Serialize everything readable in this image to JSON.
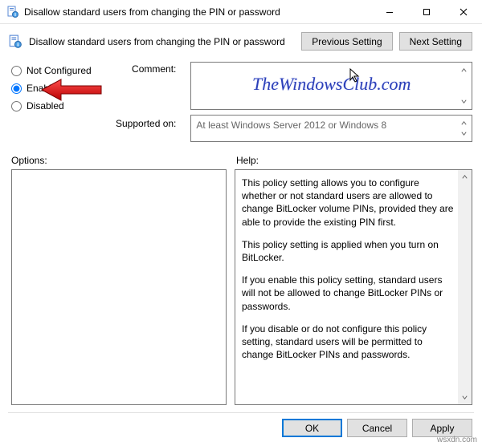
{
  "window": {
    "title": "Disallow standard users from changing the PIN or password"
  },
  "header": {
    "policy_title": "Disallow standard users from changing the PIN or password",
    "prev_label": "Previous Setting",
    "next_label": "Next Setting"
  },
  "radios": {
    "not_configured": "Not Configured",
    "enabled": "Enabled",
    "disabled": "Disabled",
    "selected": "enabled"
  },
  "labels": {
    "comment": "Comment:",
    "supported": "Supported on:",
    "options": "Options:",
    "help": "Help:"
  },
  "comment_value": "",
  "supported_value": "At least Windows Server 2012 or Windows 8",
  "help": {
    "p1": "This policy setting allows you to configure whether or not standard users are allowed to change BitLocker volume PINs, provided they are able to provide the existing PIN first.",
    "p2": "This policy setting is applied when you turn on BitLocker.",
    "p3": "If you enable this policy setting, standard users will not be allowed to change BitLocker PINs or passwords.",
    "p4": "If you disable or do not configure this policy setting, standard users will be permitted to change BitLocker PINs and passwords."
  },
  "footer": {
    "ok": "OK",
    "cancel": "Cancel",
    "apply": "Apply"
  },
  "watermark": "TheWindowsClub.com",
  "source": "wsxdn.com"
}
